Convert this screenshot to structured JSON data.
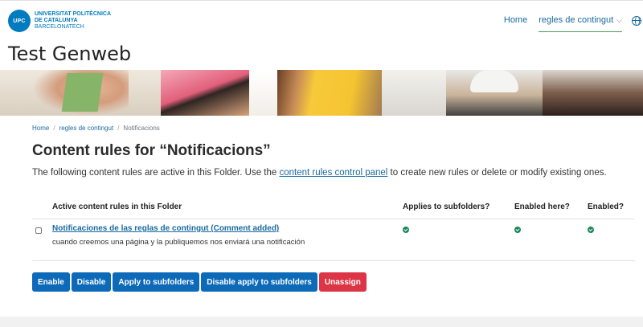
{
  "header": {
    "logo_badge": "UPC",
    "logo_lines": [
      "UNIVERSITAT POLITÈCNICA",
      "DE CATALUNYA",
      "BARCELONATECH"
    ],
    "nav_home": "Home",
    "nav_rules": "regles de contingut",
    "chevron_icon": "chevron-down-icon",
    "language_icon": "globe-icon"
  },
  "site_title": "Test Genweb",
  "breadcrumb": [
    "Home",
    "regles de contingut",
    "Notificacions"
  ],
  "page": {
    "title": "Content rules for “Notificacions”",
    "intro_before": "The following content rules are active in this Folder. Use the ",
    "intro_link": "content rules control panel",
    "intro_after": " to create new rules or delete or modify existing ones."
  },
  "table": {
    "headers": {
      "rule": "Active content rules in this Folder",
      "subfolders": "Applies to subfolders?",
      "enabled_here": "Enabled here?",
      "enabled": "Enabled?"
    },
    "rows": [
      {
        "title": "Notificaciones de las reglas de contingut (Comment added)",
        "description": "cuando creemos una página y la publiquemos nos enviará una notificación",
        "applies_to_subfolders": true,
        "enabled_here": true,
        "enabled": true
      }
    ]
  },
  "buttons": {
    "enable": "Enable",
    "disable": "Disable",
    "apply_subfolders": "Apply to subfolders",
    "disable_apply_subfolders": "Disable apply to subfolders",
    "unassign": "Unassign"
  },
  "colors": {
    "primary": "#0d6ab8",
    "danger": "#dc3545",
    "success": "#198754",
    "link": "#1a6aa0"
  }
}
